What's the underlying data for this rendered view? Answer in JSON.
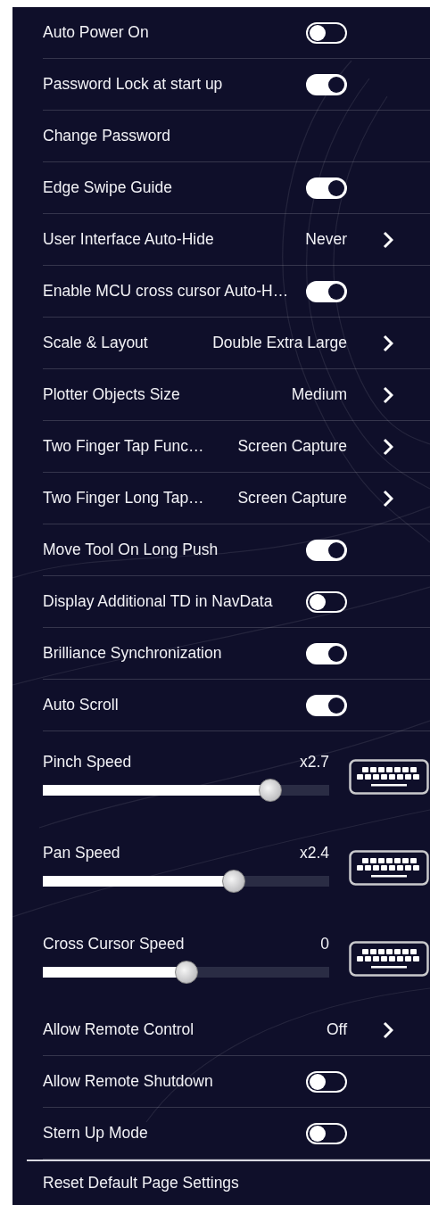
{
  "settings": [
    {
      "kind": "toggle",
      "label": "Auto Power On",
      "on": false
    },
    {
      "kind": "toggle",
      "label": "Password Lock at start up",
      "on": true
    },
    {
      "kind": "action",
      "label": "Change Password"
    },
    {
      "kind": "toggle",
      "label": "Edge Swipe Guide",
      "on": true
    },
    {
      "kind": "link",
      "label": "User Interface Auto-Hide",
      "value": "Never"
    },
    {
      "kind": "toggle",
      "label": "Enable MCU cross cursor Auto-H…",
      "on": true
    },
    {
      "kind": "link",
      "label": "Scale & Layout",
      "value": "Double Extra Large"
    },
    {
      "kind": "link",
      "label": "Plotter Objects Size",
      "value": "Medium"
    },
    {
      "kind": "link",
      "label": "Two Finger Tap Func…",
      "value": "Screen Capture"
    },
    {
      "kind": "link",
      "label": "Two Finger Long Tap…",
      "value": "Screen Capture"
    },
    {
      "kind": "toggle",
      "label": "Move Tool On Long Push",
      "on": true
    },
    {
      "kind": "toggle",
      "label": "Display Additional TD in NavData",
      "on": false
    },
    {
      "kind": "toggle",
      "label": "Brilliance Synchronization",
      "on": true
    },
    {
      "kind": "toggle",
      "label": "Auto Scroll",
      "on": true
    },
    {
      "kind": "slider",
      "label": "Pinch Speed",
      "reading": "x2.7",
      "level": 0.82
    },
    {
      "kind": "slider",
      "label": "Pan Speed",
      "reading": "x2.4",
      "level": 0.68
    },
    {
      "kind": "slider",
      "label": "Cross Cursor Speed",
      "reading": "0",
      "level": 0.5
    },
    {
      "kind": "link",
      "label": "Allow Remote Control",
      "value": "Off"
    },
    {
      "kind": "toggle",
      "label": "Allow Remote Shutdown",
      "on": false
    },
    {
      "kind": "toggle",
      "label": "Stern Up Mode",
      "on": false
    }
  ],
  "footer_action": {
    "label": "Reset Default Page Settings"
  }
}
